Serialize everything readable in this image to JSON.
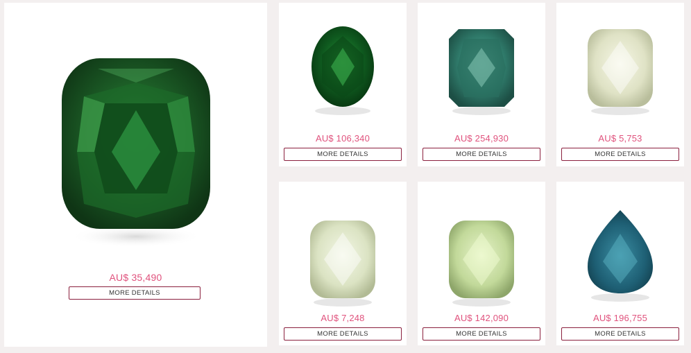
{
  "products": [
    {
      "price": "AU$ 35,490",
      "button": "MORE DETAILS",
      "gem": "green-cushion-diamond"
    },
    {
      "price": "AU$ 106,340",
      "button": "MORE DETAILS",
      "gem": "green-oval-diamond"
    },
    {
      "price": "AU$ 254,930",
      "button": "MORE DETAILS",
      "gem": "blue-green-radiant-diamond"
    },
    {
      "price": "AU$ 5,753",
      "button": "MORE DETAILS",
      "gem": "light-yellow-green-cushion-diamond"
    },
    {
      "price": "AU$ 7,248",
      "button": "MORE DETAILS",
      "gem": "light-yellow-green-cushion-diamond"
    },
    {
      "price": "AU$ 142,090",
      "button": "MORE DETAILS",
      "gem": "yellow-green-cushion-diamond"
    },
    {
      "price": "AU$ 196,755",
      "button": "MORE DETAILS",
      "gem": "blue-pear-diamond"
    }
  ],
  "colors": {
    "price": "#e0527d",
    "button_border": "#8a1f3d",
    "background": "#f3efef"
  }
}
